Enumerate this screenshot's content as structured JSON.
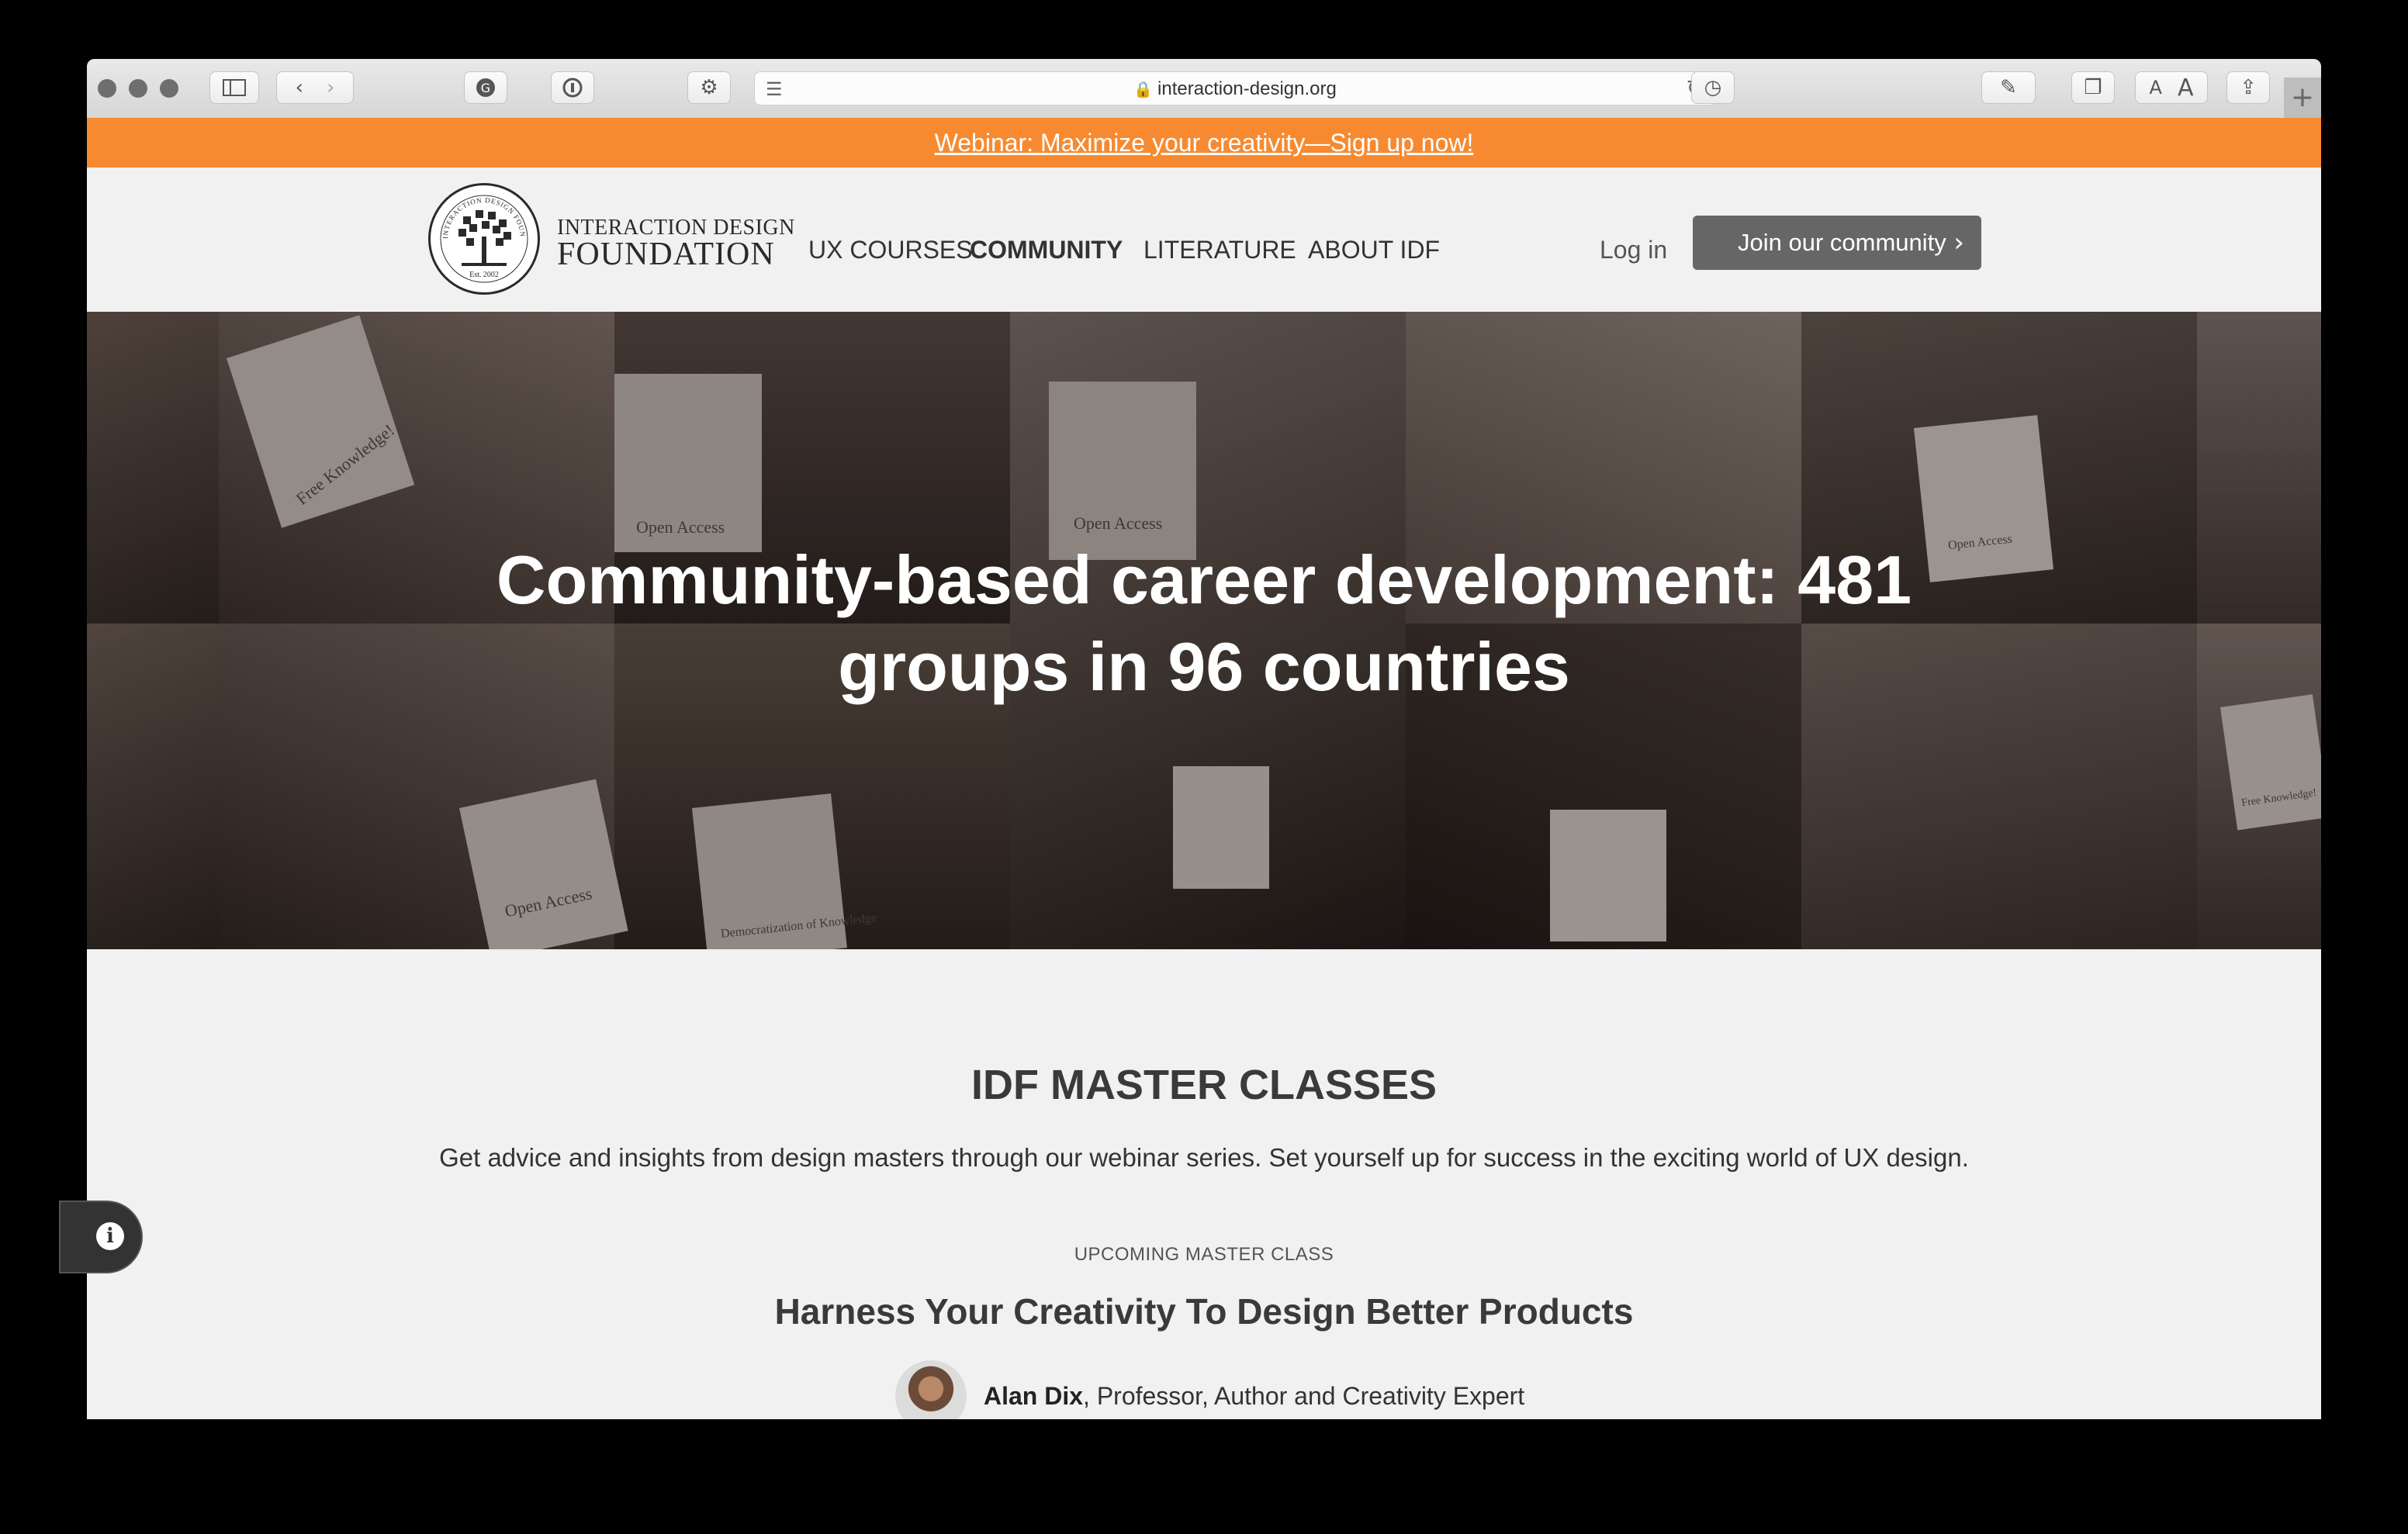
{
  "browser": {
    "url": "interaction-design.org",
    "icons": [
      "sidebar-icon",
      "back-icon",
      "forward-icon",
      "grammarly-icon",
      "1password-icon",
      "settings-icon",
      "reader-icon",
      "lock-icon",
      "reload-icon",
      "history-icon",
      "edit-icon",
      "tabs-icon",
      "share-icon",
      "new-tab-icon"
    ],
    "font_small": "A",
    "font_large": "A",
    "new_tab": "+"
  },
  "banner": {
    "text": "Webinar: Maximize your creativity—Sign up now!",
    "color": "#f78a30"
  },
  "header": {
    "logo_line1": "INTERACTION DESIGN",
    "logo_line2": "FOUNDATION",
    "logo_ring_top": "INTERACTION DESIGN FOUNDATION",
    "logo_est": "Est. 2002",
    "nav": [
      {
        "label": "UX COURSES",
        "active": false
      },
      {
        "label": "COMMUNITY",
        "active": true
      },
      {
        "label": "LITERATURE",
        "active": false
      },
      {
        "label": "ABOUT IDF",
        "active": false
      }
    ],
    "login": "Log in",
    "join": "Join our community"
  },
  "hero": {
    "title": "Community-based career development: 481 groups in 96 countries",
    "sign_texts": [
      "Free Knowledge!",
      "Open Access",
      "Open Access",
      "Open Access",
      "Open Access",
      "Democratization of Knowledge",
      "Free Knowledge!"
    ]
  },
  "masterclasses": {
    "title": "IDF MASTER CLASSES",
    "description": "Get advice and insights from design masters through our webinar series. Set yourself up for success in the exciting world of UX design.",
    "upcoming_label": "UPCOMING MASTER CLASS",
    "class_title": "Harness Your Creativity To Design Better Products",
    "speaker_name": "Alan Dix",
    "speaker_role": ", Professor, Author and Creativity Expert"
  },
  "colors": {
    "accent": "#f78a30",
    "button": "#666666",
    "text": "#333333"
  }
}
